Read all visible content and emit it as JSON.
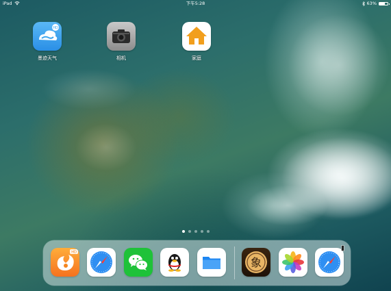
{
  "status_bar": {
    "device": "iPad",
    "time": "下午5:28",
    "battery": "63%",
    "battery_level": 0.63
  },
  "home_apps": [
    {
      "label": "墨迹天气",
      "icon": "cloud-weather-icon"
    },
    {
      "label": "相机",
      "icon": "camera-icon"
    },
    {
      "label": "家庭",
      "icon": "home-icon"
    }
  ],
  "page_dots": {
    "count": 5,
    "active_index": 0
  },
  "dock": {
    "apps": [
      {
        "icon": "uc-browser-icon"
      },
      {
        "icon": "safari-icon"
      },
      {
        "icon": "wechat-icon"
      },
      {
        "icon": "qq-penguin-icon"
      },
      {
        "icon": "files-folder-icon"
      }
    ],
    "recent_apps": [
      {
        "icon": "chinese-chess-icon",
        "glyph": "象"
      },
      {
        "icon": "photos-icon"
      },
      {
        "icon": "safari-icon"
      }
    ]
  },
  "colors": {
    "weather_blue": "#3ea6ee",
    "camera_gray": "#9b9b9b",
    "home_orange": "#f29f1d",
    "uc_orange": "#f5861f",
    "safari_blue": "#2f8ff2",
    "wechat_green": "#1ec239",
    "files_blue": "#1d86f2",
    "chess_brown": "#6b4423"
  }
}
